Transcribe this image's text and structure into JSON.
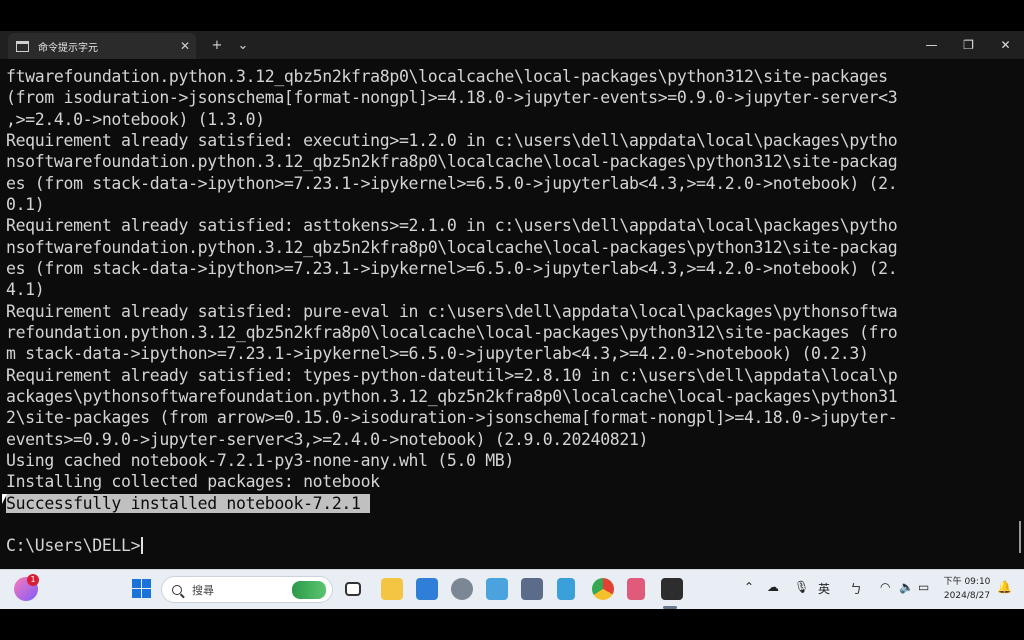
{
  "window": {
    "tab_title": "命令提示字元",
    "tab_close": "✕",
    "new_tab": "+",
    "dropdown": "⌄",
    "minimize": "—",
    "maximize": "❐",
    "close": "✕"
  },
  "terminal": {
    "lines": [
      "ftwarefoundation.python.3.12_qbz5n2kfra8p0\\localcache\\local-packages\\python312\\site-packages",
      "(from isoduration->jsonschema[format-nongpl]>=4.18.0->jupyter-events>=0.9.0->jupyter-server<3",
      ",>=2.4.0->notebook) (1.3.0)",
      "Requirement already satisfied: executing>=1.2.0 in c:\\users\\dell\\appdata\\local\\packages\\pytho",
      "nsoftwarefoundation.python.3.12_qbz5n2kfra8p0\\localcache\\local-packages\\python312\\site-packag",
      "es (from stack-data->ipython>=7.23.1->ipykernel>=6.5.0->jupyterlab<4.3,>=4.2.0->notebook) (2.",
      "0.1)",
      "Requirement already satisfied: asttokens>=2.1.0 in c:\\users\\dell\\appdata\\local\\packages\\pytho",
      "nsoftwarefoundation.python.3.12_qbz5n2kfra8p0\\localcache\\local-packages\\python312\\site-packag",
      "es (from stack-data->ipython>=7.23.1->ipykernel>=6.5.0->jupyterlab<4.3,>=4.2.0->notebook) (2.",
      "4.1)",
      "Requirement already satisfied: pure-eval in c:\\users\\dell\\appdata\\local\\packages\\pythonsoftwa",
      "refoundation.python.3.12_qbz5n2kfra8p0\\localcache\\local-packages\\python312\\site-packages (fro",
      "m stack-data->ipython>=7.23.1->ipykernel>=6.5.0->jupyterlab<4.3,>=4.2.0->notebook) (0.2.3)",
      "Requirement already satisfied: types-python-dateutil>=2.8.10 in c:\\users\\dell\\appdata\\local\\p",
      "ackages\\pythonsoftwarefoundation.python.3.12_qbz5n2kfra8p0\\localcache\\local-packages\\python31",
      "2\\site-packages (from arrow>=0.15.0->isoduration->jsonschema[format-nongpl]>=4.18.0->jupyter-",
      "events>=0.9.0->jupyter-server<3,>=2.4.0->notebook) (2.9.0.20240821)",
      "Using cached notebook-7.2.1-py3-none-any.whl (5.0 MB)",
      "Installing collected packages: notebook",
      "Successfully installed notebook-7.2.1 ",
      "",
      "C:\\Users\\DELL>"
    ],
    "highlight_line": "Successfully installed notebook-7.2.1 "
  },
  "taskbar": {
    "badge_count": "1",
    "search_placeholder": "搜尋",
    "ime_label": "英",
    "clock_time": "下午 09:10",
    "clock_date": "2024/8/27"
  }
}
